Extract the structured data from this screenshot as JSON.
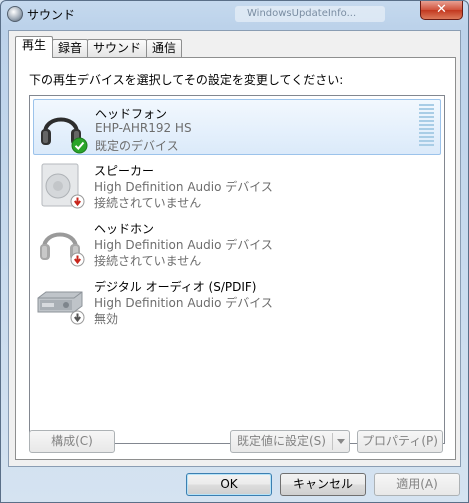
{
  "window": {
    "title": "サウンド",
    "close_label": "✕",
    "background_window_label": "WindowsUpdateInfo..."
  },
  "tabs": [
    {
      "label": "再生",
      "active": true
    },
    {
      "label": "録音",
      "active": false
    },
    {
      "label": "サウンド",
      "active": false
    },
    {
      "label": "通信",
      "active": false
    }
  ],
  "instruction": "下の再生デバイスを選択してその設定を変更してください:",
  "devices": [
    {
      "name": "ヘッドフォン",
      "model": "EHP-AHR192 HS",
      "status": "既定のデバイス",
      "icon": "headphones-icon",
      "badge": "default-check-badge",
      "selected": true
    },
    {
      "name": "スピーカー",
      "model": "High Definition Audio デバイス",
      "status": "接続されていません",
      "icon": "speaker-icon",
      "badge": "disconnected-badge",
      "selected": false
    },
    {
      "name": "ヘッドホン",
      "model": "High Definition Audio デバイス",
      "status": "接続されていません",
      "icon": "headphones-icon",
      "badge": "disconnected-badge",
      "selected": false
    },
    {
      "name": "デジタル オーディオ (S/PDIF)",
      "model": "High Definition Audio デバイス",
      "status": "無効",
      "icon": "digital-audio-icon",
      "badge": "disabled-badge",
      "selected": false
    }
  ],
  "buttons": {
    "configure": "構成(C)",
    "set_default": "既定値に設定(S)",
    "properties": "プロパティ(P)",
    "ok": "OK",
    "cancel": "キャンセル",
    "apply": "適用(A)"
  },
  "colors": {
    "accent_selected": "#dbeafa",
    "ok_check": "#2aa52a",
    "disconnected_badge": "#c8261c",
    "disabled_badge": "#555555"
  }
}
